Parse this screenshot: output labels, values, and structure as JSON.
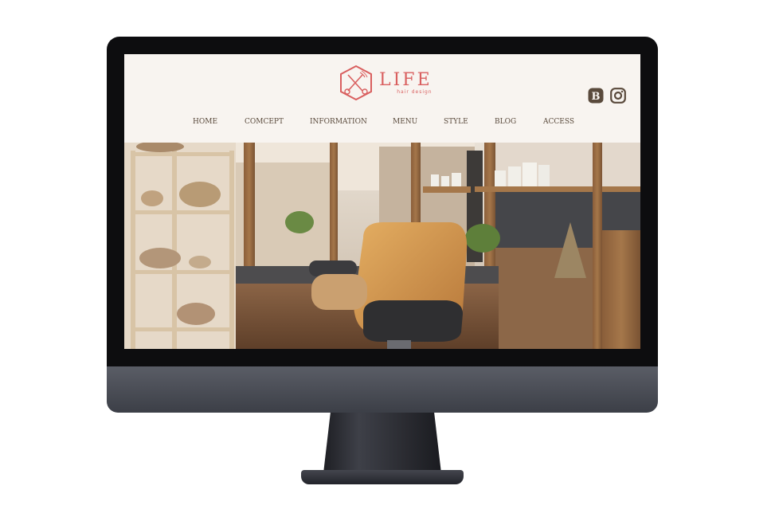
{
  "brand": {
    "name": "LIFE",
    "tagline": "hair design",
    "color": "#d95f5f"
  },
  "social": {
    "icons": [
      "blog-b-icon",
      "instagram-icon"
    ],
    "color": "#5a4a3c"
  },
  "nav": {
    "items": [
      {
        "label": "HOME"
      },
      {
        "label": "COMCEPT"
      },
      {
        "label": "INFORMATION"
      },
      {
        "label": "MENU"
      },
      {
        "label": "STYLE"
      },
      {
        "label": "BLOG"
      },
      {
        "label": "ACCESS"
      }
    ]
  },
  "colors": {
    "screen_bg": "#f8f4f0",
    "nav_text": "#5a4a3c",
    "wood": "#a5774a",
    "chair": "#d29a50"
  }
}
